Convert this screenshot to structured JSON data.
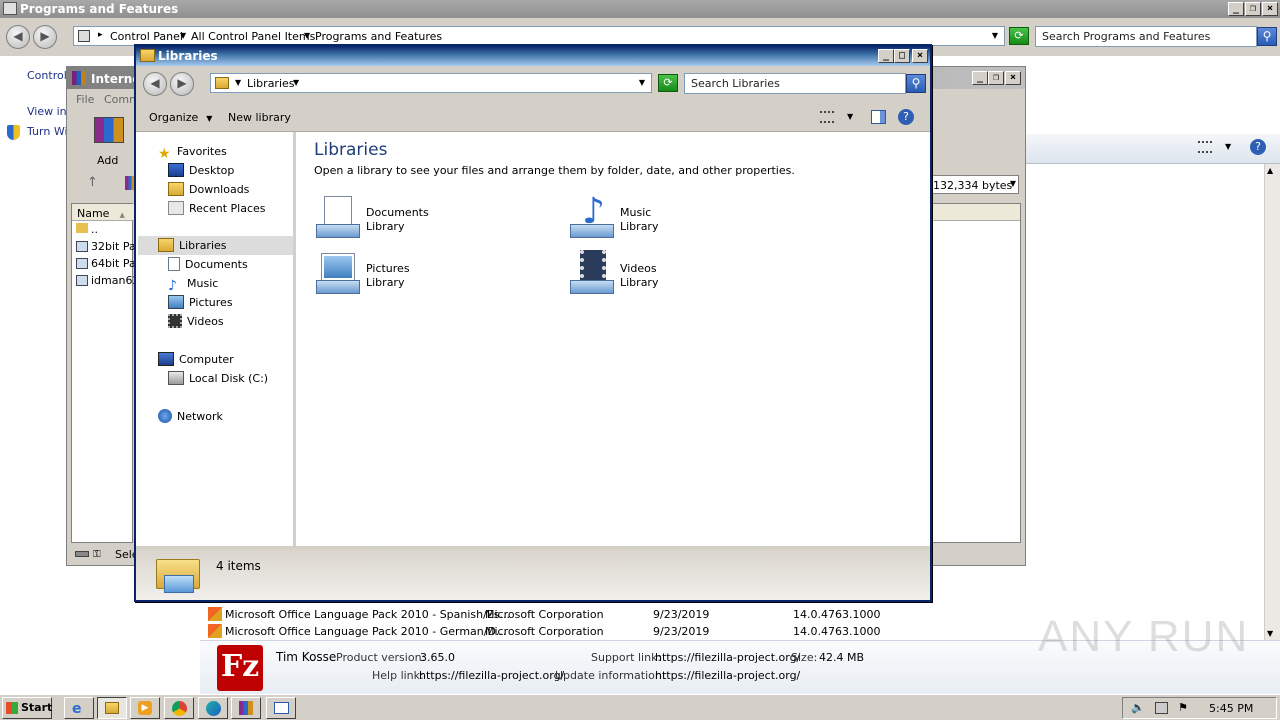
{
  "bg_window": {
    "title": "Programs and Features",
    "breadcrumbs": [
      "Control Panel",
      "All Control Panel Items",
      "Programs and Features"
    ],
    "search_placeholder": "Search Programs and Features",
    "sidebar_texts": [
      "Control",
      "View ins",
      "Turn Wi"
    ],
    "rows": [
      {
        "name": "Microsoft Office Language Pack 2010 - Spanish/Es...",
        "publisher": "Microsoft Corporation",
        "installed": "9/23/2019",
        "version": "14.0.4763.1000"
      },
      {
        "name": "Microsoft Office Language Pack 2010 - German/D...",
        "publisher": "Microsoft Corporation",
        "installed": "9/23/2019",
        "version": "14.0.4763.1000"
      }
    ],
    "details": {
      "publisher": "Tim Kosse",
      "product_version_label": "Product version:",
      "product_version": "3.65.0",
      "support_label": "Support link:",
      "support_link": "https://filezilla-project.org/",
      "size_label": "Size:",
      "size": "42.4 MB",
      "help_label": "Help link:",
      "help_link": "https://filezilla-project.org/",
      "update_label": "Update information:",
      "update_link": "https://filezilla-project.org/"
    }
  },
  "winrar_window": {
    "title": "Interne",
    "menu": [
      "File",
      "Comm"
    ],
    "add_label": "Add",
    "name_col": "Name",
    "files": [
      "..",
      "32bit Pa",
      "64bit Pa",
      "idman62"
    ],
    "bytes": "132,334 bytes",
    "status": "Sele"
  },
  "explorer": {
    "title": "Libraries",
    "address": "Libraries",
    "search_placeholder": "Search Libraries",
    "toolbar": {
      "organize": "Organize",
      "new_library": "New library"
    },
    "nav": {
      "favorites": "Favorites",
      "favorites_items": [
        "Desktop",
        "Downloads",
        "Recent Places"
      ],
      "libraries": "Libraries",
      "libraries_items": [
        "Documents",
        "Music",
        "Pictures",
        "Videos"
      ],
      "computer": "Computer",
      "computer_items": [
        "Local Disk (C:)"
      ],
      "network": "Network"
    },
    "heading": "Libraries",
    "subheading": "Open a library to see your files and arrange them by folder, date, and other properties.",
    "libraries": [
      {
        "name": "Documents",
        "sub": "Library"
      },
      {
        "name": "Music",
        "sub": "Library"
      },
      {
        "name": "Pictures",
        "sub": "Library"
      },
      {
        "name": "Videos",
        "sub": "Library"
      }
    ],
    "status": "4 items"
  },
  "taskbar": {
    "start": "Start",
    "time": "5:45 PM"
  },
  "watermark": "ANY RUN"
}
